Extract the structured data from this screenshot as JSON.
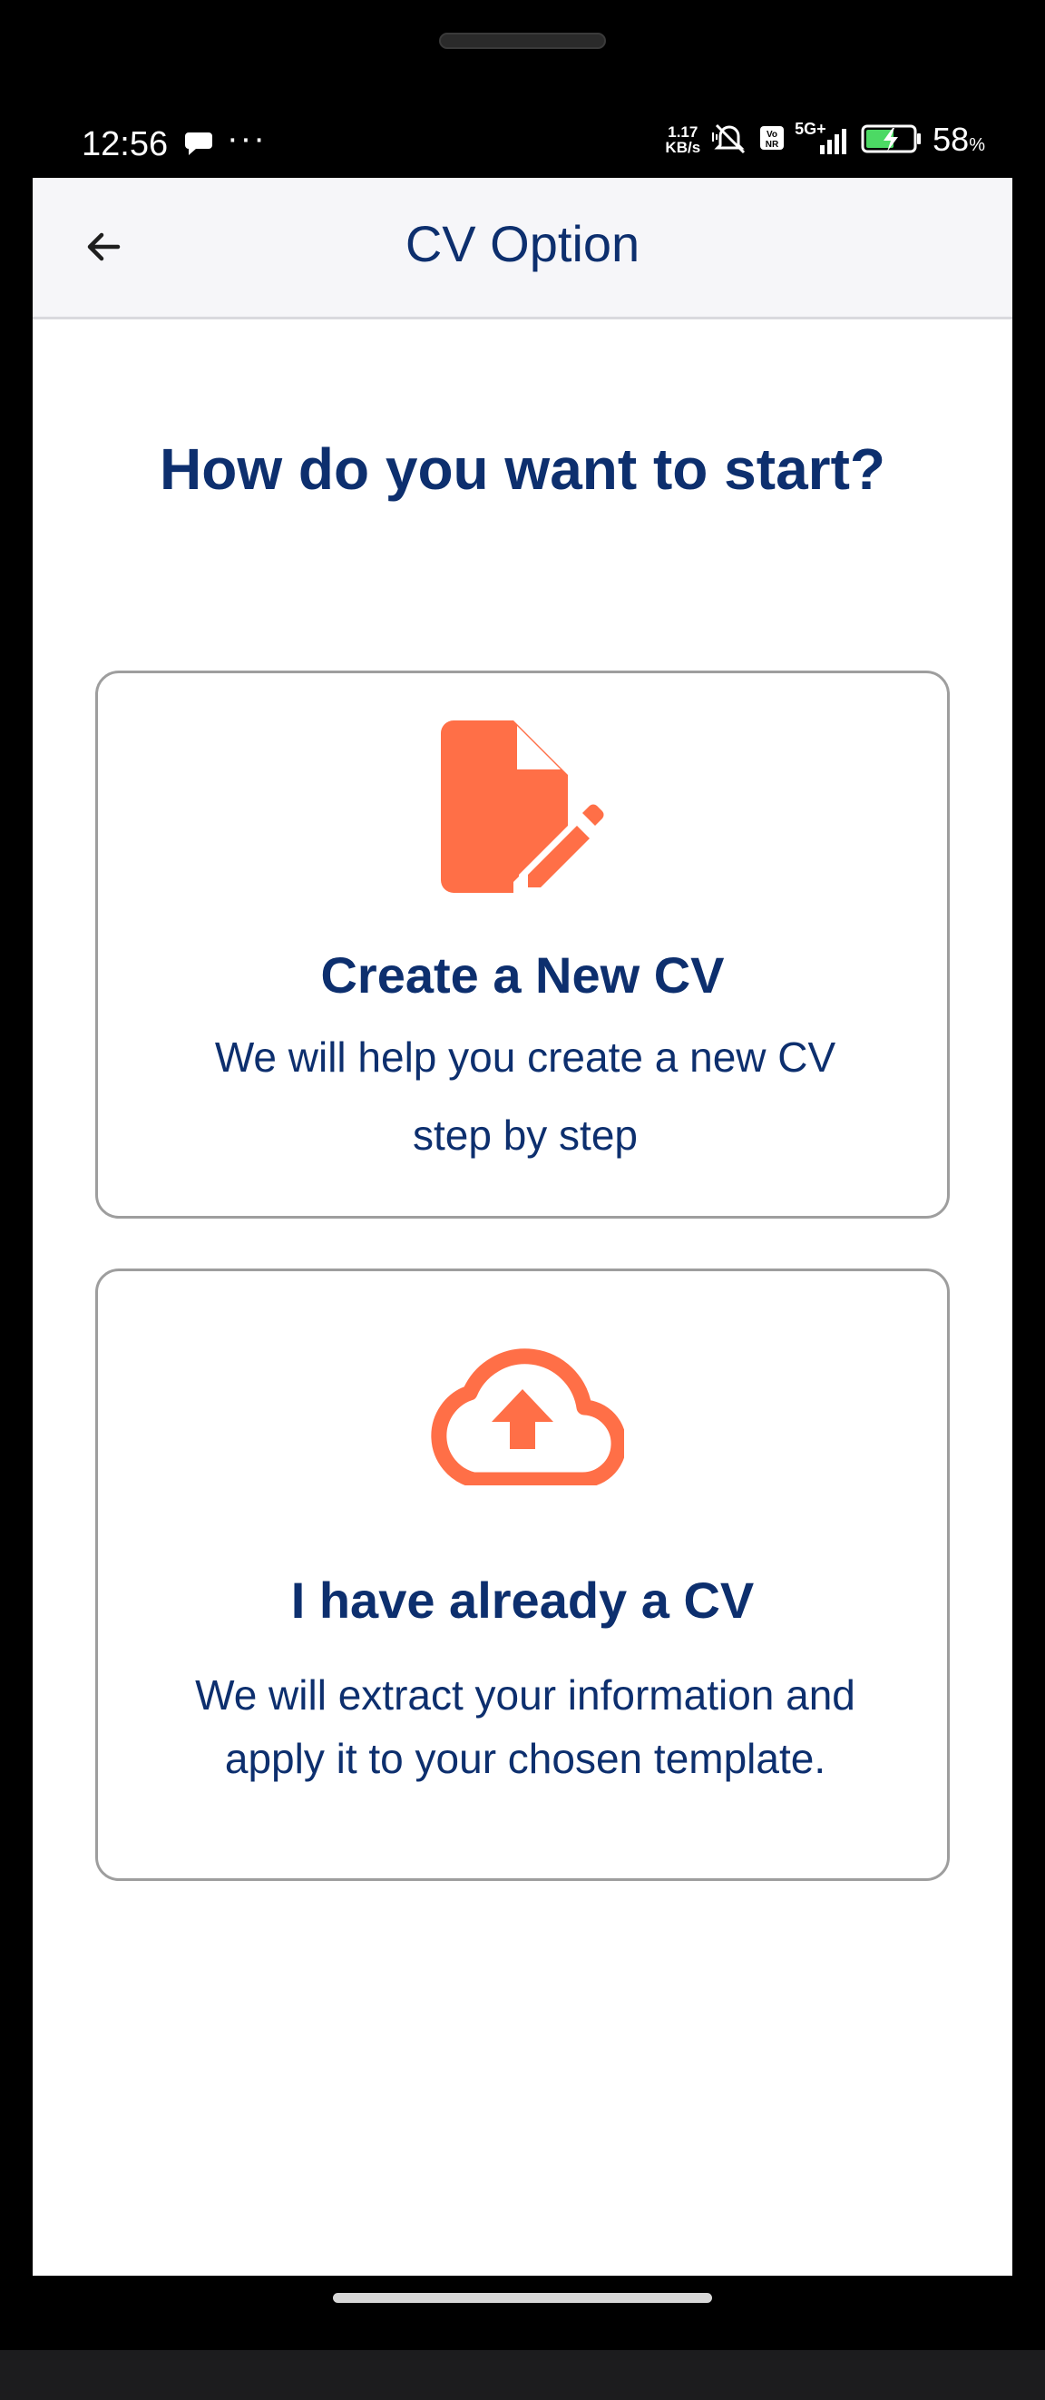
{
  "status_bar": {
    "time": "12:56",
    "net_speed_value": "1.17",
    "net_speed_unit": "KB/s",
    "network": "5G+",
    "battery_percent": "58",
    "battery_unit": "%",
    "icons": [
      "chat-bubble-icon",
      "more-dots-icon",
      "mute-icon",
      "volte-icon",
      "signal-icon",
      "battery-charging-icon"
    ]
  },
  "app_bar": {
    "title": "CV Option",
    "back_icon": "arrow-left-icon"
  },
  "main": {
    "heading": "How do you want to start?",
    "options": [
      {
        "icon": "edit-document-icon",
        "title": "Create a New CV",
        "description": "We will help you create a new CV step by step"
      },
      {
        "icon": "cloud-upload-icon",
        "title": "I have already a CV",
        "description": "We will extract your information and apply it to your chosen template."
      }
    ]
  },
  "colors": {
    "accent": "#ff6f47",
    "text_primary": "#0d2f6e",
    "app_bar_bg": "#f6f6f9",
    "card_border": "#9e9e9e"
  }
}
